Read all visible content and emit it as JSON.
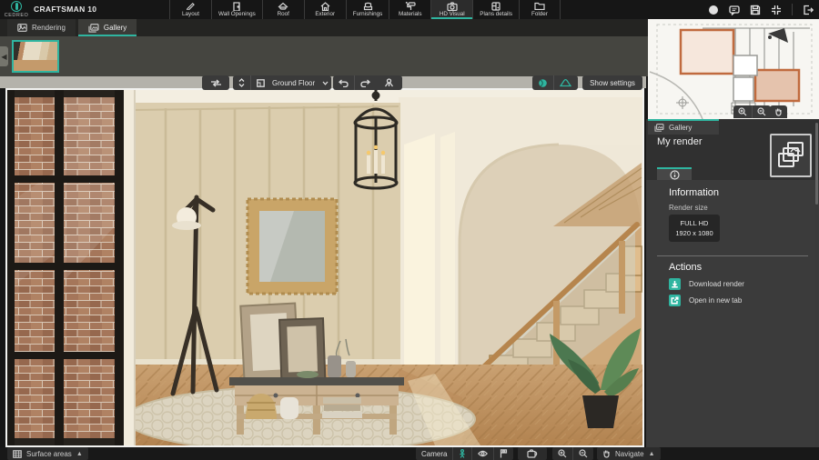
{
  "app": {
    "brand": "CEDREO",
    "project_name": "CRAFTSMAN 10",
    "menu": [
      {
        "label": "Layout",
        "icon": "pencil-icon"
      },
      {
        "label": "Wall Openings",
        "icon": "door-icon"
      },
      {
        "label": "Roof",
        "icon": "roof-icon"
      },
      {
        "label": "Exterior",
        "icon": "house-icon"
      },
      {
        "label": "Furnishings",
        "icon": "armchair-icon"
      },
      {
        "label": "Materials",
        "icon": "paint-roller-icon"
      },
      {
        "label": "HD Visual",
        "icon": "camera-icon",
        "active": true
      },
      {
        "label": "Plans details",
        "icon": "plan-icon"
      },
      {
        "label": "Folder",
        "icon": "folder-icon"
      }
    ],
    "topbar_icons": [
      "help-icon",
      "chat-icon",
      "save-icon",
      "center-view-icon",
      "logout-icon"
    ]
  },
  "view_tabs": [
    {
      "label": "Rendering",
      "active": false
    },
    {
      "label": "Gallery",
      "active": true
    }
  ],
  "toolbar": {
    "floor_selector_value": "Ground Floor",
    "show_settings_label": "Show settings",
    "icons": [
      "compare-icon",
      "floor-stepper-icon",
      "undo-icon",
      "redo-icon",
      "camera-tripod-icon",
      "sphere-view-icon",
      "panorama-icon",
      "eye-icon"
    ]
  },
  "right_panel": {
    "tab_label": "Gallery",
    "title": "My render",
    "info_section": {
      "heading": "Information",
      "render_size_label": "Render size",
      "render_size_line1": "FULL HD",
      "render_size_line2": "1920 x 1080"
    },
    "actions_section": {
      "heading": "Actions",
      "items": [
        {
          "label": "Download render",
          "icon": "download-icon"
        },
        {
          "label": "Open in new tab",
          "icon": "external-link-icon"
        }
      ]
    }
  },
  "minimap": {
    "controls": [
      "zoom-in-icon",
      "zoom-out-icon",
      "pan-hand-icon"
    ]
  },
  "bottom_bar": {
    "surface_areas_label": "Surface areas",
    "camera_label": "Camera",
    "navigate_label": "Navigate",
    "camera_modes": [
      "walkthrough-person-icon",
      "aerial-view-icon",
      "elevation-view-icon"
    ],
    "tools": [
      "switch-camera-icon",
      "zoom-in-icon",
      "zoom-out-icon",
      "pan-hand-icon"
    ]
  },
  "colors": {
    "accent_teal": "#2fb5a0",
    "topbar_bg": "#161616",
    "panel_bg": "#3b3b3b",
    "workspace_band": "#b4b2ab",
    "bottombar_bg": "#181818"
  }
}
